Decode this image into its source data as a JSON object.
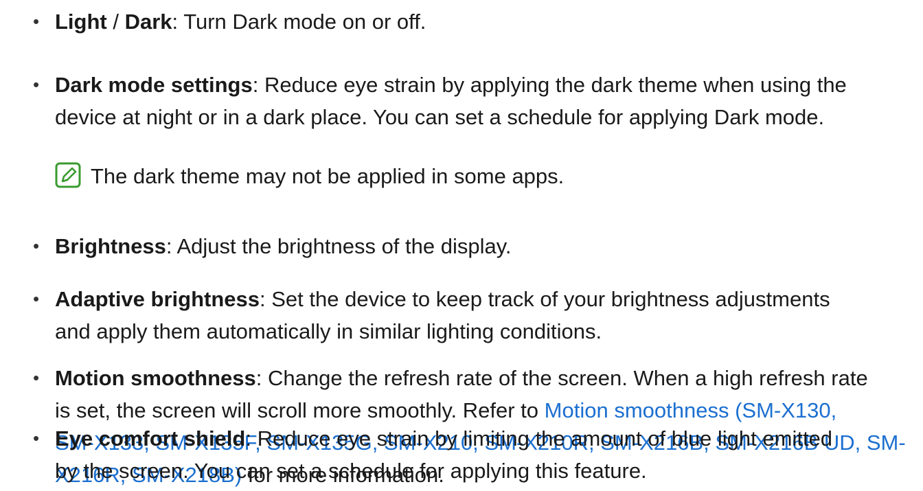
{
  "items": [
    {
      "term": "Light",
      "sep": " / ",
      "term2": "Dark",
      "colon": ":",
      "desc": " Turn Dark mode on or off."
    },
    {
      "term": "Dark mode settings",
      "colon": ":",
      "desc_line1": " Reduce eye strain by applying the dark theme when using the",
      "desc_line2": "device at night or in a dark place. You can set a schedule for applying Dark mode."
    },
    {
      "term": "Brightness",
      "colon": ":",
      "desc": " Adjust the brightness of the display."
    },
    {
      "term": "Adaptive brightness",
      "colon": ":",
      "desc_line1": " Set the device to keep track of your brightness adjustments",
      "desc_line2": "and apply them automatically in similar lighting conditions."
    },
    {
      "term": "Motion smoothness",
      "colon": ":",
      "desc_line1": " Change the refresh rate of the screen. When a high refresh rate",
      "desc_line2": "is set, the screen will scroll more smoothly. Refer to ",
      "link_line2": "Motion smoothness (SM-X130,",
      "link_line3": "SM-X133, SM-X135F, SM-X135G, SM-X210, SM-X210R, SM-X216B, SM-X216B UD, SM-",
      "link_line4": "X216R, SM-X218B)",
      "desc_line4": " for more information."
    },
    {
      "term": "Eye comfort shield",
      "colon": ":",
      "desc_line1": " Reduce eye strain by limiting the amount of blue light emitted",
      "desc_line2": "by the screen. You can set a schedule for applying this feature."
    }
  ],
  "note": {
    "icon": "note-pencil-icon",
    "text": "The dark theme may not be applied in some apps."
  },
  "bullet_char": "•",
  "colors": {
    "text": "#1a1a1a",
    "link": "#1b6fd0",
    "note_icon": "#3a9a2f"
  }
}
